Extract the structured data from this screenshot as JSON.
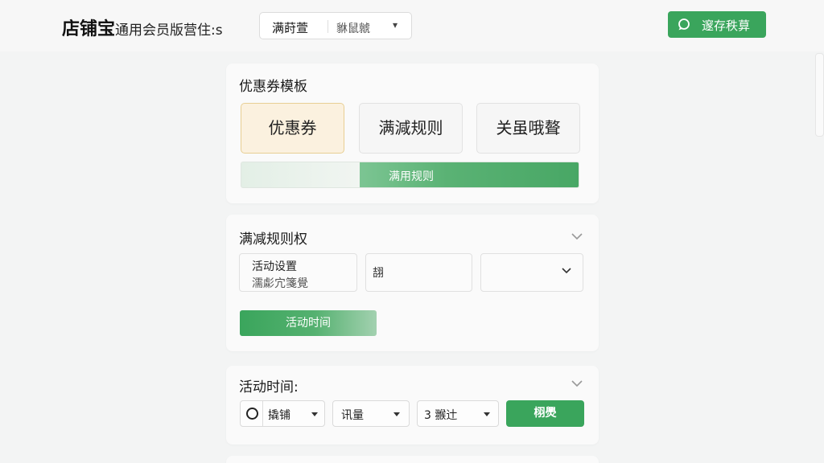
{
  "header": {
    "app_name": "店铺宝",
    "app_subtitle": "通用会员版营住:s",
    "store_select": {
      "value": "满莳萱",
      "secondary": "貅鼠虩"
    },
    "contact_button": "邃存秩萛"
  },
  "template_section": {
    "title": "优惠券模板",
    "tiles": [
      {
        "label": "优惠券",
        "selected": true
      },
      {
        "label": "满減规则",
        "selected": false
      },
      {
        "label": "关虽哦聱",
        "selected": false
      }
    ],
    "progress": {
      "label": "满用规则",
      "fraction": 0.65
    }
  },
  "rules_section": {
    "title": "满减规则权",
    "field_activity": {
      "title": "活动设置",
      "subtitle": "濡虨宂箋覺"
    },
    "field_input": "翓",
    "dropdown_value": "",
    "button": "活动时间"
  },
  "time_section": {
    "title": "活动时间:",
    "selects": [
      {
        "label": "撬铺"
      },
      {
        "label": "讯量"
      },
      {
        "label": "3 翭辻"
      }
    ],
    "confirm_button": "栩爂"
  },
  "colors": {
    "accent_green": "#3aa55c",
    "selected_tile_bg": "#fbf1df",
    "selected_tile_border": "#e8cf94"
  }
}
